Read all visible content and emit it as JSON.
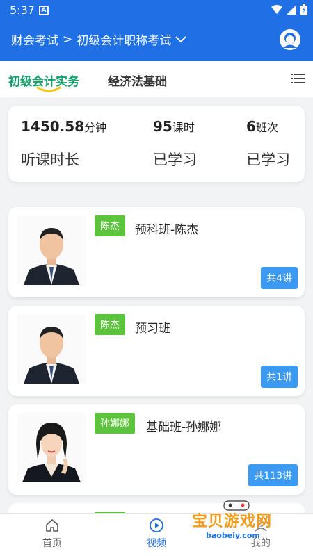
{
  "status_bar": {
    "time": "5:37"
  },
  "header": {
    "breadcrumb_root": "财会考试",
    "breadcrumb_sep": ">",
    "breadcrumb_current": "初级会计职称考试"
  },
  "tabs": [
    {
      "label": "初级会计实务",
      "active": true
    },
    {
      "label": "经济法基础",
      "active": false
    }
  ],
  "stats": {
    "duration_value": "1450.58",
    "duration_unit": "分钟",
    "duration_label": "听课时长",
    "lessons_value": "95",
    "lessons_unit": "课时",
    "lessons_label": "已学习",
    "classes_value": "6",
    "classes_unit": "班次",
    "classes_label": "已学习"
  },
  "courses": [
    {
      "teacher": "陈杰",
      "title": "预科班-陈杰",
      "count": "共4讲"
    },
    {
      "teacher": "陈杰",
      "title": "预习班",
      "count": "共1讲"
    },
    {
      "teacher": "孙娜娜",
      "title": "基础班-孙娜娜",
      "count": "共113讲"
    }
  ],
  "bottom_nav": [
    {
      "label": "首页",
      "active": false
    },
    {
      "label": "视频",
      "active": true
    },
    {
      "label": "我的",
      "active": false
    }
  ],
  "watermark": {
    "text": "宝贝游戏网",
    "url": "baobeiy.com"
  },
  "colors": {
    "primary": "#1f6fe5",
    "tab_active": "#14a06a",
    "tag_green": "#5cc43c",
    "count_blue": "#3d9af2"
  }
}
